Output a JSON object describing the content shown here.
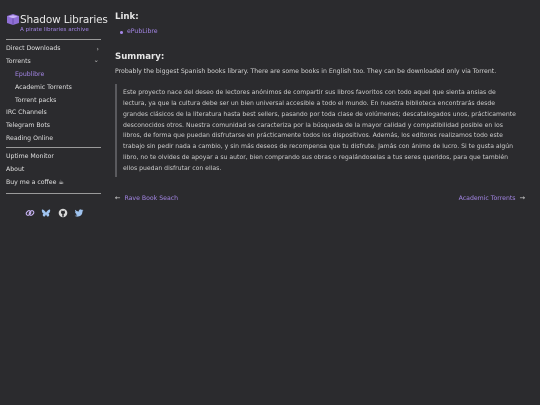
{
  "brand": {
    "title": "Shadow Libraries",
    "subtitle": "A pirate libraries archive"
  },
  "sidebar": {
    "items": [
      {
        "label": "Direct Downloads",
        "chevron": "›"
      },
      {
        "label": "Torrents",
        "chevron": "⌄"
      },
      {
        "label": "Epublibre"
      },
      {
        "label": "Academic Torrents"
      },
      {
        "label": "Torrent packs"
      },
      {
        "label": "IRC Channels"
      },
      {
        "label": "Telegram Bots"
      },
      {
        "label": "Reading Online"
      },
      {
        "label": "Uptime Monitor"
      },
      {
        "label": "About"
      },
      {
        "label": "Buy me a coffee ☕"
      }
    ],
    "social_icons": [
      "link-icon",
      "bluesky-icon",
      "github-icon",
      "twitter-icon"
    ]
  },
  "main": {
    "link_heading": "Link:",
    "link_label": "ePubLibre",
    "summary_heading": "Summary:",
    "summary_text": "Probably the biggest Spanish books library. There are some books in English too. They can be downloaded only via Torrent.",
    "quote": "Este proyecto nace del deseo de lectores anónimos de compartir sus libros favoritos con todo aquel que sienta ansias de lectura, ya que la cultura debe ser un bien universal accesible a todo el mundo. En nuestra biblioteca encontrarás desde grandes clásicos de la literatura hasta best sellers, pasando por toda clase de volúmenes; descatalogados unos, prácticamente desconocidos otros. Nuestra comunidad se caracteriza por la búsqueda de la mayor calidad y compatibilidad posible en los libros, de forma que puedan disfrutarse en prácticamente todos los dispositivos. Además, los editores realizamos todo este trabajo sin pedir nada a cambio, y sin más deseos de recompensa que tu disfrute. Jamás con ánimo de lucro. Si te gusta algún libro, no te olvides de apoyar a su autor, bien comprando sus obras o regalándoselas a tus seres queridos, para que también ellos puedan disfrutar con ellas.",
    "prev_label": "Rave Book Seach",
    "next_label": "Academic Torrents"
  },
  "colors": {
    "background": "#2b2b2e",
    "accent": "#a486e6",
    "text": "#d6d6d6",
    "rule": "#9a9a9a"
  }
}
